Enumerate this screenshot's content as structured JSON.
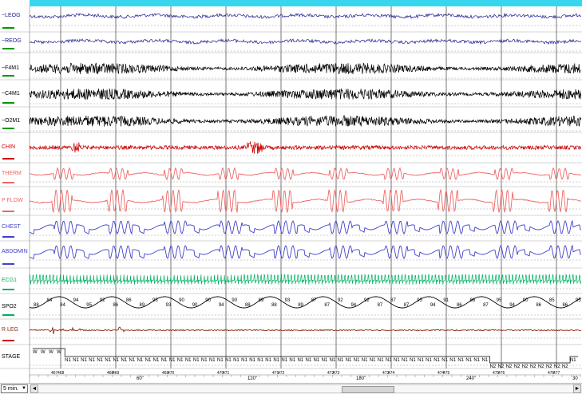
{
  "colors": {
    "header_strip": "#36d6ee",
    "eog": "#1a1a8c",
    "eeg": "#000000",
    "chin": "#cc0000",
    "therm": "#ee6666",
    "pflow": "#ee6666",
    "effort": "#4040cc",
    "ecg": "#00b060",
    "spo2": "#000000",
    "leg": "#8b2a10",
    "epoch_line": "#555555",
    "grid": "#8a8a8a"
  },
  "channels": [
    {
      "name": "~LEOG",
      "color": "#1a1a8c",
      "mark_color": "#009900",
      "type": "eog"
    },
    {
      "name": "~REOG",
      "color": "#1a1a8c",
      "mark_color": "#009900",
      "type": "eog"
    },
    {
      "name": "~F4M1",
      "color": "#000000",
      "mark_color": "#009900",
      "type": "eeg"
    },
    {
      "name": "~C4M1",
      "color": "#000000",
      "mark_color": "#009900",
      "type": "eeg"
    },
    {
      "name": "~O2M1",
      "color": "#000000",
      "mark_color": "#009900",
      "type": "eeg"
    },
    {
      "name": "CHIN",
      "color": "#cc0000",
      "mark_color": "#cc0000",
      "type": "chin"
    },
    {
      "name": "THERM",
      "color": "#ee6666",
      "mark_color": "#ee6666",
      "type": "therm"
    },
    {
      "name": "P FLOW",
      "color": "#ee6666",
      "mark_color": "#ee6666",
      "type": "pflow"
    },
    {
      "name": "CHEST",
      "color": "#4040cc",
      "mark_color": "#4040cc",
      "type": "effort"
    },
    {
      "name": "ABDOMIN",
      "color": "#4040cc",
      "mark_color": "#4040cc",
      "type": "effort"
    },
    {
      "name": "ECG1",
      "color": "#00b060",
      "mark_color": "#00b060",
      "type": "ecg"
    },
    {
      "name": "SPO2",
      "color": "#000000",
      "mark_color": "#00b060",
      "type": "spo2"
    },
    {
      "name": "R LEG",
      "color": "#8b2a10",
      "mark_color": "#cc0000",
      "type": "leg"
    },
    {
      "name": "STAGE",
      "color": "#000000",
      "mark_color": "",
      "type": "stage"
    }
  ],
  "spo2_values": [
    "88",
    "84",
    "84",
    "94",
    "95",
    "92",
    "86",
    "86",
    "89",
    "95",
    "93",
    "90",
    "90",
    "90",
    "94",
    "90",
    "88",
    "89",
    "88",
    "93",
    "89",
    "87",
    "87",
    "92",
    "94",
    "92",
    "87",
    "87",
    "87",
    "95",
    "94",
    "91",
    "86",
    "86",
    "87",
    "95",
    "94",
    "90",
    "86",
    "85",
    "86",
    "95"
  ],
  "stage_labels": [
    "W",
    "W",
    "W",
    "W",
    "N1",
    "N1",
    "N1",
    "N1",
    "N1",
    "N1",
    "N1",
    "N1",
    "N1",
    "N1",
    "N1",
    "N1",
    "N1",
    "N1",
    "N1",
    "N1",
    "N1",
    "N1",
    "N1",
    "N1",
    "N1",
    "N1",
    "N1",
    "N1",
    "N1",
    "N1",
    "N1",
    "N1",
    "N1",
    "N1",
    "N1",
    "N1",
    "N1",
    "N1",
    "N1",
    "N1",
    "N1",
    "N1",
    "N1",
    "N1",
    "N1",
    "N1",
    "N1",
    "N1",
    "N1",
    "N1",
    "N1",
    "N1",
    "N1",
    "N1",
    "N1",
    "N1",
    "N1",
    "N2",
    "N2",
    "N2",
    "N2",
    "N2",
    "N2",
    "N2",
    "N2",
    "N2",
    "N2",
    "N1"
  ],
  "epoch_numbers": [
    "467",
    "468",
    "468",
    "469",
    "469",
    "470",
    "470",
    "471",
    "471",
    "472",
    "472",
    "473",
    "473",
    "474",
    "474",
    "475",
    "475",
    "476",
    "476",
    "477"
  ],
  "time_marks": [
    "60\"",
    "120\"",
    "180\"",
    "240\"",
    "30"
  ],
  "bottom": {
    "zoom_value": "5 min.",
    "zoom_arrow": "▼",
    "scroll_left": "◄",
    "scroll_right": "►"
  }
}
